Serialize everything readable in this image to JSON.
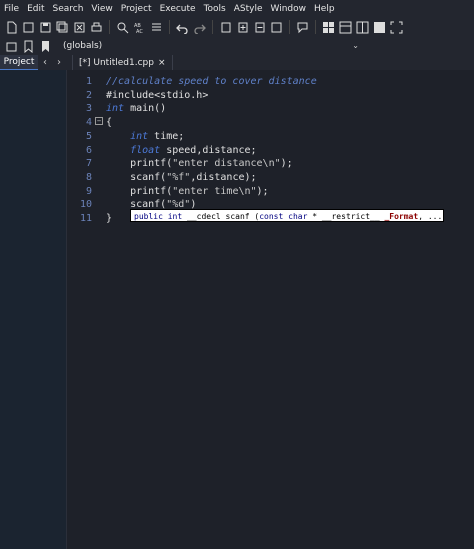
{
  "menu": [
    "File",
    "Edit",
    "Search",
    "View",
    "Project",
    "Execute",
    "Tools",
    "AStyle",
    "Window",
    "Help"
  ],
  "toolbar": {
    "globals_label": "(globals)"
  },
  "tabs": {
    "project_label": "Project",
    "file_tab_label": "[*] Untitled1.cpp",
    "close_glyph": "×"
  },
  "code": {
    "line_numbers": [
      "1",
      "2",
      "3",
      "4",
      "5",
      "6",
      "7",
      "8",
      "9",
      "10",
      "11"
    ],
    "lines": [
      "//calculate speed to cover distance",
      "#include<stdio.h>",
      "int main()",
      "{",
      "    int time;",
      "    float speed,distance;",
      "    printf(\"enter distance\\n\");",
      "    scanf(\"%f\",distance);",
      "    printf(\"enter time\\n\");",
      "    scanf(\"%d\")",
      "}"
    ]
  },
  "calltip": {
    "text": "public int __cdecl scanf (const char * __restrict__ _Format, ...)"
  },
  "colors": {
    "background": "#1e2129",
    "comment": "#5f80c8",
    "keyword": "#4d7ad8",
    "line_number": "#6b82b8"
  }
}
